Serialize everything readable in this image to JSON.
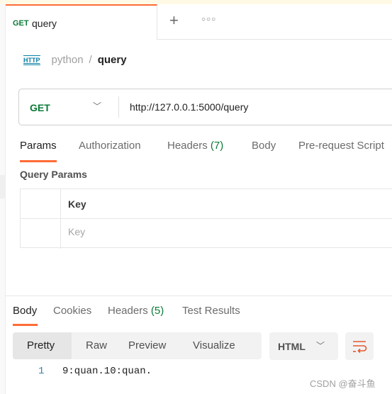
{
  "tab": {
    "method": "GET",
    "name": "query"
  },
  "tabstrip": {
    "new_tab_icon": "plus-icon",
    "more_icon": "ellipsis-icon"
  },
  "breadcrumb": {
    "icon": "http-icon",
    "icon_text": "HTTP",
    "collection": "python",
    "separator": "/",
    "request": "query"
  },
  "request": {
    "method": "GET",
    "url": "http://127.0.0.1:5000/query"
  },
  "request_tabs": [
    {
      "label": "Params",
      "active": true
    },
    {
      "label": "Authorization"
    },
    {
      "label": "Headers",
      "count": "(7)"
    },
    {
      "label": "Body"
    },
    {
      "label": "Pre-request Script"
    }
  ],
  "query_params": {
    "title": "Query Params",
    "header_key": "Key",
    "placeholder_key": "Key"
  },
  "response_tabs": [
    {
      "label": "Body",
      "active": true
    },
    {
      "label": "Cookies"
    },
    {
      "label": "Headers",
      "count": "(5)"
    },
    {
      "label": "Test Results"
    }
  ],
  "view_modes": [
    "Pretty",
    "Raw",
    "Preview",
    "Visualize"
  ],
  "format": "HTML",
  "response_lines": [
    {
      "n": "1",
      "text": "9:quan.10:quan."
    }
  ],
  "watermark": "CSDN @奋斗鱼",
  "colors": {
    "accent": "#ff6c37",
    "method_get": "#0c7a38"
  }
}
